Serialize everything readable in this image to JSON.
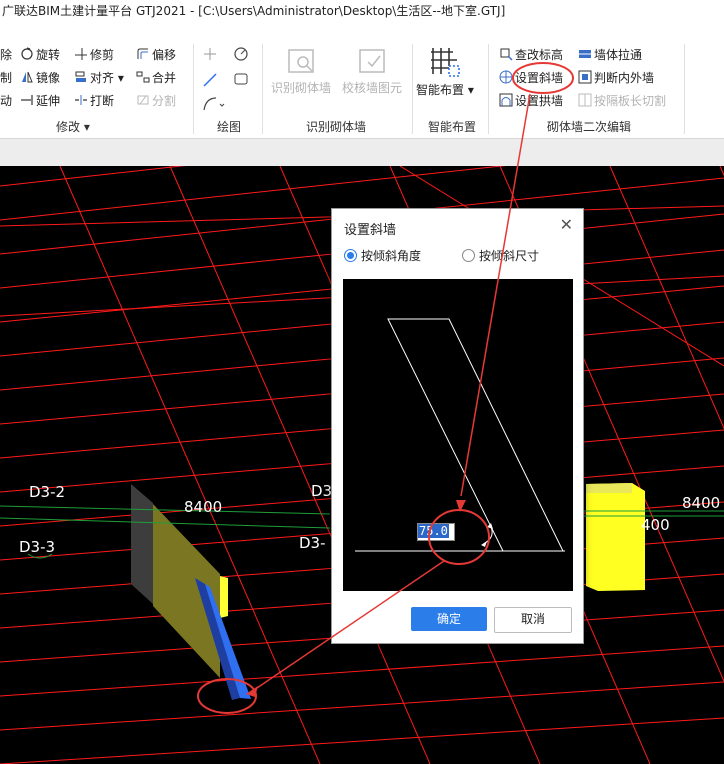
{
  "window": {
    "title": "广联达BIM土建计量平台 GTJ2021 - [C:\\Users\\Administrator\\Desktop\\生活区--地下室.GTJ]"
  },
  "ribbon": {
    "modify": {
      "label": "修改",
      "items": {
        "delete": "除",
        "copy": "制",
        "move": "动",
        "rotate": "旋转",
        "mirror": "镜像",
        "extend": "延伸",
        "trim": "修剪",
        "align": "对齐",
        "break": "打断",
        "offset": "偏移",
        "merge": "合并",
        "split": "分割"
      }
    },
    "draw": {
      "label": "绘图"
    },
    "identify": {
      "label": "识别砌体墙",
      "identify_wall": "识别砌体墙",
      "check_wall": "校核墙图元"
    },
    "smart": {
      "label": "智能布置",
      "smart_layout": "智能布置"
    },
    "secondary": {
      "label": "砌体墙二次编辑",
      "check_elev": "查改标高",
      "wall_extend": "墙体拉通",
      "set_slant": "设置斜墙",
      "judge_inout": "判断内外墙",
      "set_arch": "设置拱墙",
      "cut_by_slab": "按隔板长切割"
    }
  },
  "viewport": {
    "labels": {
      "d3_2": "D3-2",
      "d3_3": "D3-3",
      "d3_top": "D3",
      "d3_mid": "D3-",
      "dim_8400_left": "8400",
      "dim_8400_right": "8400",
      "dim_400": "400"
    }
  },
  "dialog": {
    "title": "设置斜墙",
    "radio_angle": "按倾斜角度",
    "radio_size": "按倾斜尺寸",
    "angle_value": "75.0",
    "ok": "确定",
    "cancel": "取消"
  },
  "colors": {
    "grid_red": "#ff1a1a",
    "annotation_red": "#e53935",
    "wall_olive": "#7f7a1f",
    "wall_blue": "#2f6ff0",
    "wall_yellow": "#ffff33",
    "accent_blue": "#2b7de9"
  }
}
